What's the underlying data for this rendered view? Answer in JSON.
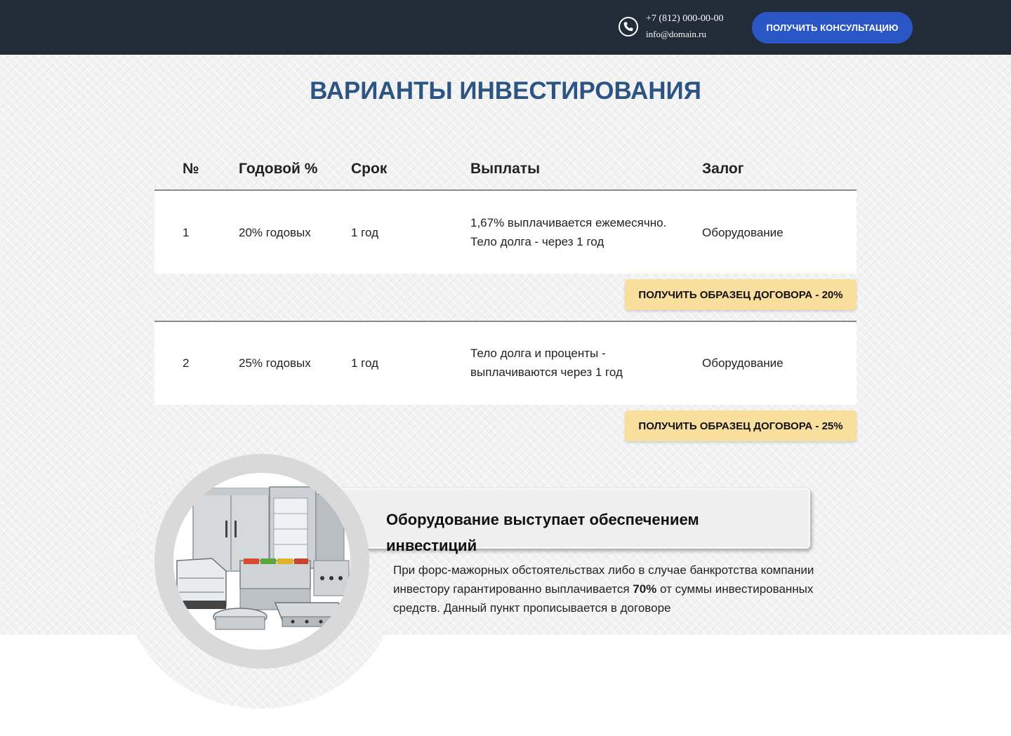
{
  "header": {
    "phone": "+7 (812) 000-00-00",
    "email": "info@domain.ru",
    "consult_button": "ПОЛУЧИТЬ КОНСУЛЬТАЦИЮ",
    "phone_icon": "phone-icon"
  },
  "section": {
    "title": "ВАРИАНТЫ ИНВЕСТИРОВАНИЯ"
  },
  "table": {
    "headers": [
      "№",
      "Годовой %",
      "Срок",
      "Выплаты",
      "Залог"
    ],
    "rows": [
      {
        "num": "1",
        "rate": "20% годовых",
        "term": "1 год",
        "payments_line1": "1,67% выплачивается ежемесячно.",
        "payments_line2": "Тело долга - через 1 год",
        "collateral": "Оборудование",
        "button": "ПОЛУЧИТЬ ОБРАЗЕЦ ДОГОВОРА - 20%"
      },
      {
        "num": "2",
        "rate": "25% годовых",
        "term": "1 год",
        "payments_line1": "Тело долга и проценты -",
        "payments_line2": "выплачиваются через 1 год",
        "collateral": "Оборудование",
        "button": "ПОЛУЧИТЬ ОБРАЗЕЦ ДОГОВОРА - 25%"
      }
    ]
  },
  "guarantee": {
    "title": "Оборудование выступает обеспечением инвестиций",
    "text_before": "При форс-мажорных обстоятельствах либо в случае банкротства компании инвестору гарантированно выплачивается ",
    "text_bold": "70%",
    "text_after": " от суммы инвестированных средств. Данный пункт прописывается в договоре",
    "image": "kitchen-equipment-image"
  },
  "colors": {
    "topbar": "#222b38",
    "accent_button": "#2a56c6",
    "title": "#2d5583",
    "sample_button": "#f9df9e"
  }
}
